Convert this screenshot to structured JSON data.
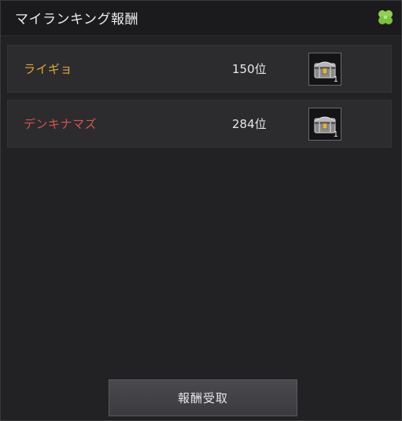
{
  "header": {
    "title": "マイランキング報酬",
    "icon": "clover-icon"
  },
  "colors": {
    "gold_name": "#e3a933",
    "red_name": "#d9534f"
  },
  "rankings": [
    {
      "name": "ライギョ",
      "rank": "150位",
      "reward_icon": "treasure-chest-icon",
      "reward_count": "1"
    },
    {
      "name": "デンキナマズ",
      "rank": "284位",
      "reward_icon": "treasure-chest-icon",
      "reward_count": "1"
    }
  ],
  "footer": {
    "claim_label": "報酬受取"
  }
}
